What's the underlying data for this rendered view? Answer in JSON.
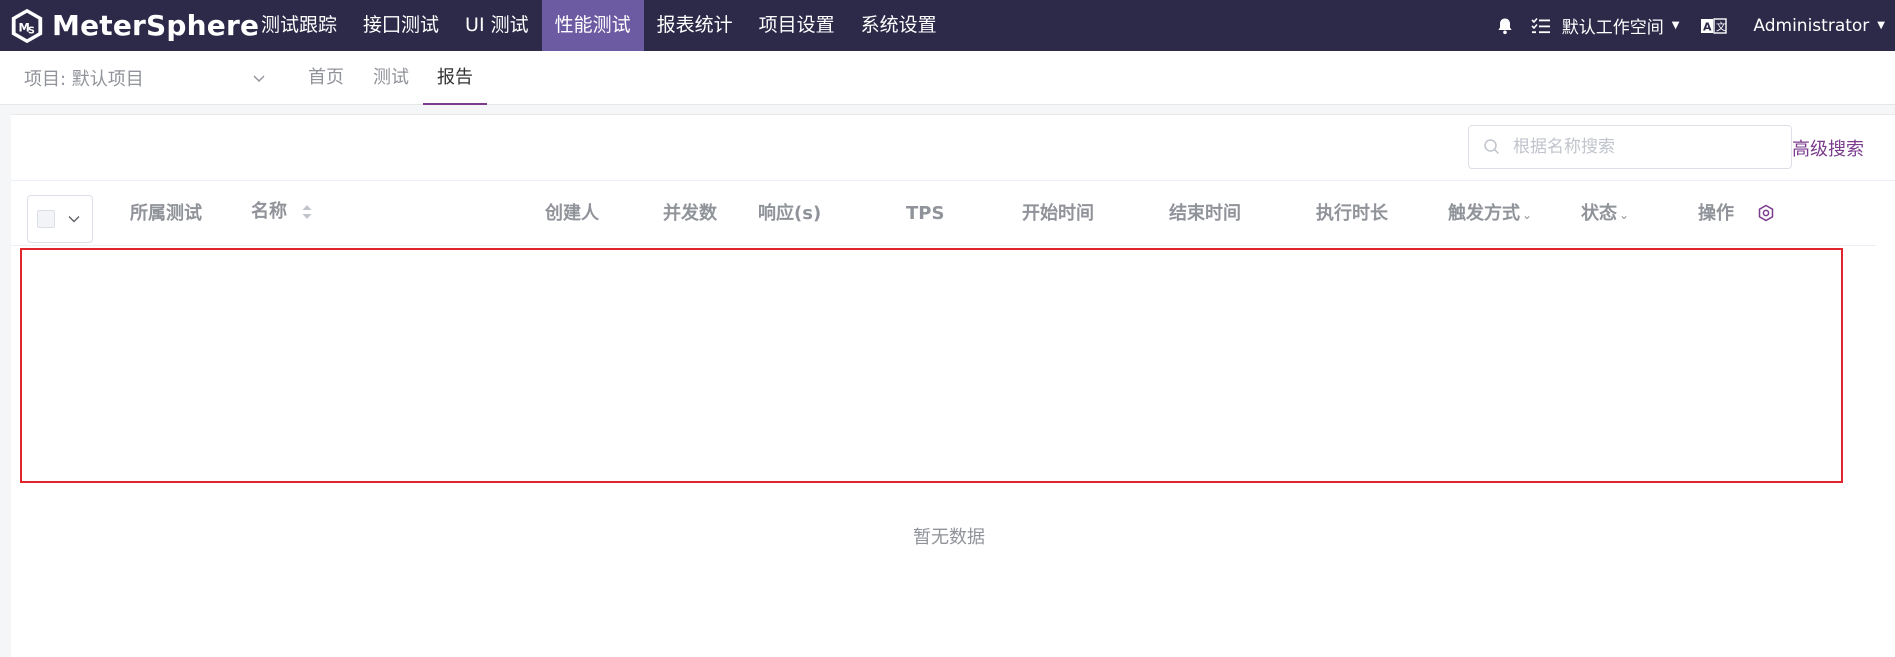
{
  "app": {
    "logo_text": "MeterSphere"
  },
  "nav": {
    "items": [
      {
        "label": "测试跟踪"
      },
      {
        "label": "接囗测试"
      },
      {
        "label": "UI 测试"
      },
      {
        "label": "性能测试",
        "active": true
      },
      {
        "label": "报表统计"
      },
      {
        "label": "项目设置"
      },
      {
        "label": "系统设置"
      }
    ]
  },
  "top_right": {
    "workspace": "默认工作空间",
    "user": "Administrator",
    "icons": [
      "bell-icon",
      "task-list-icon",
      "language-icon"
    ]
  },
  "subbar": {
    "project_label": "项目: 默认项目",
    "tabs": [
      {
        "label": "首页"
      },
      {
        "label": "测试"
      },
      {
        "label": "报告",
        "active": true
      }
    ]
  },
  "search": {
    "placeholder": "根据名称搜索",
    "advanced_label": "高级搜索"
  },
  "table": {
    "columns": {
      "test": "所属测试",
      "name": "名称",
      "creator": "创建人",
      "concurrency": "并发数",
      "response": "响应(s)",
      "tps": "TPS",
      "start_time": "开始时间",
      "end_time": "结束时间",
      "duration": "执行时长",
      "trigger": "触发方式",
      "status": "状态",
      "operation": "操作"
    },
    "empty_text": "暂无数据"
  },
  "colors": {
    "topbar": "#2c2a48",
    "active_nav": "#6c5aa2",
    "accent": "#7b3c8c",
    "highlight": "#e0262c"
  }
}
